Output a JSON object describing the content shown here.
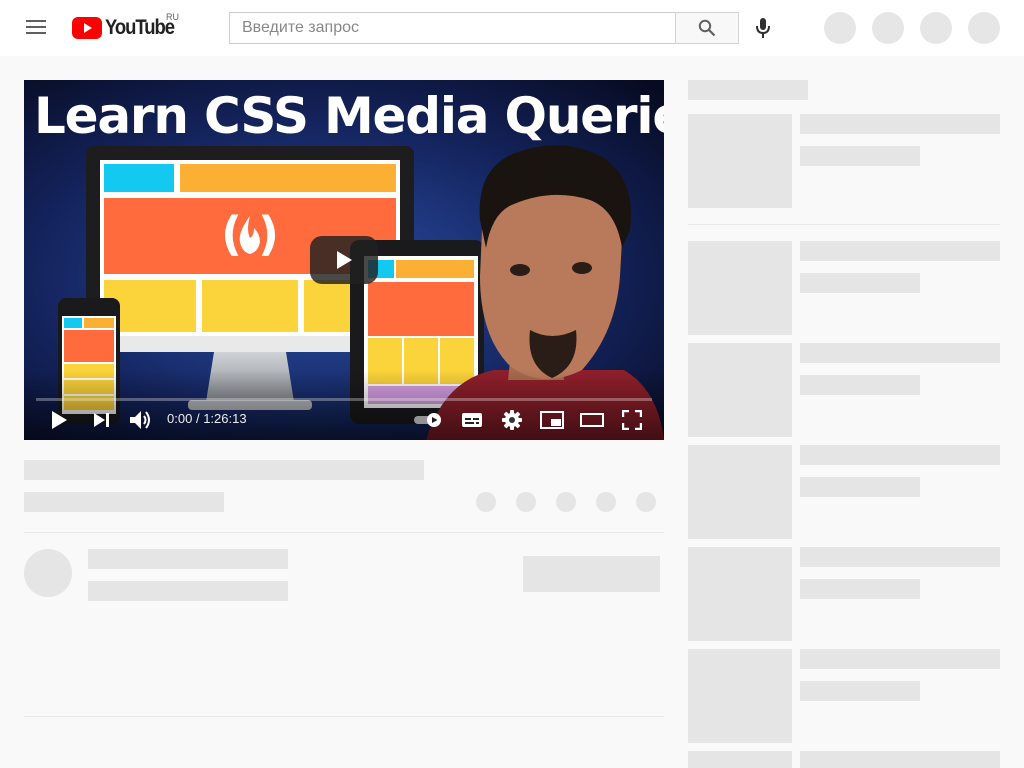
{
  "masthead": {
    "logo_text": "YouTube",
    "region": "RU",
    "search_placeholder": "Введите запрос",
    "icons": [
      "menu-icon",
      "search-icon",
      "mic-icon"
    ]
  },
  "player": {
    "thumbnail_title": "Learn CSS Media Queries",
    "time_current": "0:00",
    "time_separator": "/",
    "time_duration": "1:26:13",
    "progress": 0,
    "colors": {
      "accent_red": "#ff0000",
      "tile_cyan": "#13c9f0",
      "tile_orange": "#fbb034",
      "tile_coral": "#ff6b3d",
      "tile_yellow": "#fbd33a"
    },
    "controls": [
      "play-icon",
      "next-icon",
      "volume-icon",
      "autoplay-toggle",
      "subtitles-icon",
      "settings-icon",
      "miniplayer-icon",
      "theater-icon",
      "fullscreen-icon"
    ]
  },
  "loading_state": {
    "skeleton_color": "#e5e5e5",
    "page_background": "#f9f9f9"
  }
}
